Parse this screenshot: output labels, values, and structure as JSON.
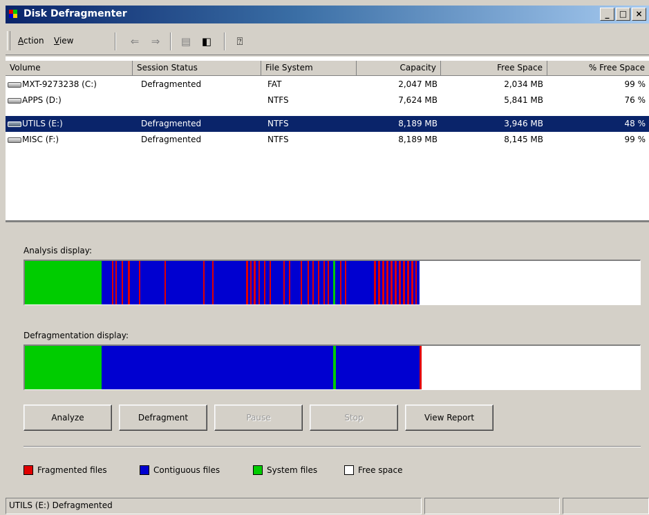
{
  "window": {
    "title": "Disk Defragmenter",
    "controls": [
      "minimize",
      "maximize",
      "close"
    ]
  },
  "toolbar": {
    "menus": [
      {
        "label": "Action",
        "accelerator": "A"
      },
      {
        "label": "View",
        "accelerator": "V"
      }
    ],
    "icons": [
      "back-arrow-icon",
      "forward-arrow-icon",
      "properties-icon",
      "show-hide-tree-icon",
      "help-icon"
    ]
  },
  "volumes": {
    "columns": [
      "Volume",
      "Session Status",
      "File System",
      "Capacity",
      "Free Space",
      "% Free Space"
    ],
    "rows": [
      {
        "volume": "MXT-9273238 (C:)",
        "status": "Defragmented",
        "fs": "FAT",
        "capacity": "2,047 MB",
        "free": "2,034 MB",
        "pct": "99 %",
        "selected": false
      },
      {
        "volume": "APPS (D:)",
        "status": "",
        "fs": "NTFS",
        "capacity": "7,624 MB",
        "free": "5,841 MB",
        "pct": "76 %",
        "selected": false
      },
      {
        "volume": "UTILS (E:)",
        "status": "Defragmented",
        "fs": "NTFS",
        "capacity": "8,189 MB",
        "free": "3,946 MB",
        "pct": "48 %",
        "selected": true
      },
      {
        "volume": "MISC (F:)",
        "status": "Defragmented",
        "fs": "NTFS",
        "capacity": "8,189 MB",
        "free": "8,145 MB",
        "pct": "99 %",
        "selected": false
      }
    ]
  },
  "analysis": {
    "label": "Analysis display:"
  },
  "defrag": {
    "label": "Defragmentation display:"
  },
  "buttons": {
    "analyze": "Analyze",
    "defragment": "Defragment",
    "pause": "Pause",
    "stop": "Stop",
    "view_report": "View Report"
  },
  "legend": {
    "fragmented": "Fragmented files",
    "contiguous": "Contiguous files",
    "system": "System files",
    "free": "Free space",
    "colors": {
      "fragmented": "#e00000",
      "contiguous": "#0000d0",
      "system": "#00cc00",
      "free": "#ffffff"
    }
  },
  "status": {
    "text": "UTILS (E:) Defragmented"
  }
}
